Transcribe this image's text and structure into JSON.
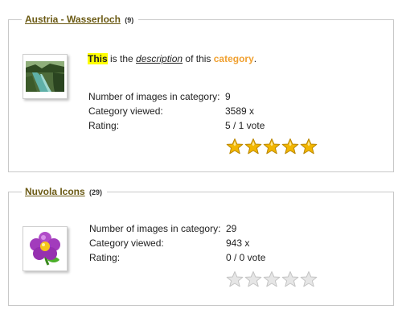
{
  "categories": [
    {
      "title": "Austria - Wasserloch",
      "count": "(9)",
      "description": {
        "highlight": "This",
        "text1": " is the ",
        "emphasis": "description",
        "text2": " of this ",
        "category_word": "category",
        "end": "."
      },
      "stats": [
        {
          "label": "Number of images in category:",
          "value": "9"
        },
        {
          "label": "Category viewed:",
          "value": "3589 x"
        },
        {
          "label": "Rating:",
          "value": "5 / 1 vote"
        }
      ],
      "rating_stars": 5,
      "thumbnail_icon": "waterfall-photo"
    },
    {
      "title": "Nuvola Icons",
      "count": "(29)",
      "stats": [
        {
          "label": "Number of images in category:",
          "value": "29"
        },
        {
          "label": "Category viewed:",
          "value": "943 x"
        },
        {
          "label": "Rating:",
          "value": "0 / 0 vote"
        }
      ],
      "rating_stars": 0,
      "thumbnail_icon": "purple-flower-icon"
    }
  ],
  "colors": {
    "title_link": "#6b5a14",
    "category_word": "#f0a030",
    "highlight": "#ffff00",
    "star_filled": "#f2b600",
    "star_empty": "#e6e6e6"
  }
}
